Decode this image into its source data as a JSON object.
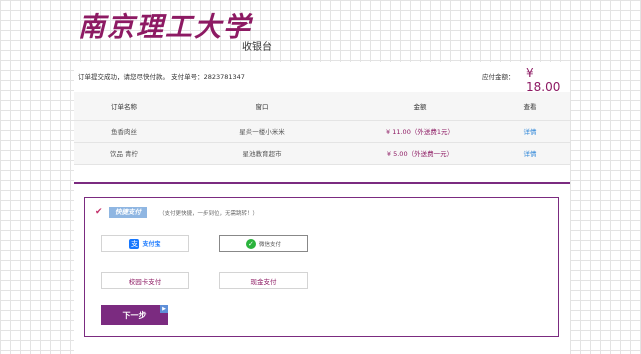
{
  "header": {
    "logo": "南京理工大学",
    "cashier_label": "收银台"
  },
  "order_info": {
    "notice": "订单提交成功，请您尽快付款。 支付单号：2823781347",
    "amount_label": "应付金额：",
    "amount_value": "¥ 18.00"
  },
  "orders": {
    "headers": [
      "订单名称",
      "窗口",
      "金额",
      "查看"
    ],
    "rows": [
      {
        "name": "鱼香肉丝",
        "window": "星炎一楼小米米",
        "price": "¥ 11.00（外送费1元）",
        "link": "详情"
      },
      {
        "name": "饮品 青柠",
        "window": "星池教育超市",
        "price": "¥ 5.00（外送费一元）",
        "link": "详情"
      }
    ]
  },
  "payment": {
    "check_mark": "✔",
    "quick_pay_badge": "快捷支付",
    "quick_pay_tip": "（支付更快捷，一步到位，无需跳转！）",
    "alipay_mark": "支",
    "alipay_label": "支付宝",
    "wechat_mark": "✓",
    "wechat_label": "微信支付",
    "card_label": "校园卡支付",
    "cash_label": "现金支付",
    "next_label": "下一步"
  },
  "colors": {
    "brand": "#8d1a63",
    "accent": "#7b2b80",
    "link": "#2e86d8"
  }
}
